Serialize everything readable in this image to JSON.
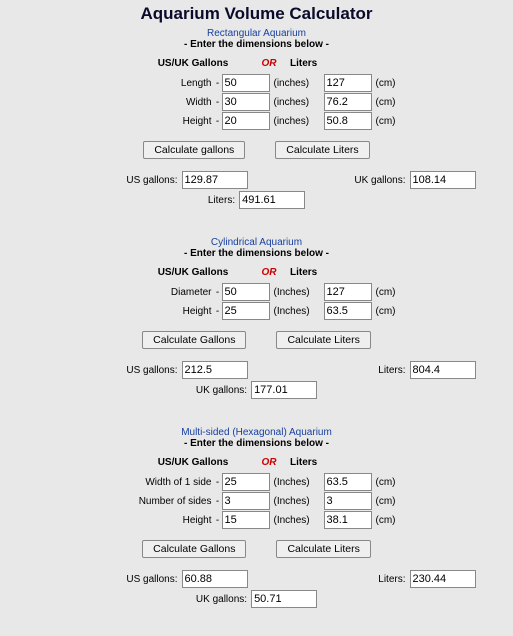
{
  "title": "Aquarium Volume Calculator",
  "headers": {
    "usuk": "US/UK Gallons",
    "or": "OR",
    "liters": "Liters"
  },
  "instruction": "- Enter the dimensions below -",
  "rect": {
    "title": "Rectangular Aquarium",
    "rows": {
      "length": {
        "label": "Length",
        "in": "50",
        "cm": "127"
      },
      "width": {
        "label": "Width",
        "in": "30",
        "cm": "76.2"
      },
      "height": {
        "label": "Height",
        "in": "20",
        "cm": "50.8"
      }
    },
    "unit_in": "(inches)",
    "unit_cm": "(cm)",
    "btn_gal": "Calculate gallons",
    "btn_lit": "Calculate Liters",
    "res": {
      "us_label": "US gallons:",
      "us": "129.87",
      "uk_label": "UK gallons:",
      "uk": "108.14",
      "l_label": "Liters:",
      "l": "491.61"
    }
  },
  "cyl": {
    "title": "Cylindrical  Aquarium",
    "rows": {
      "diameter": {
        "label": "Diameter",
        "in": "50",
        "cm": "127"
      },
      "height": {
        "label": "Height",
        "in": "25",
        "cm": "63.5"
      }
    },
    "unit_in": "(Inches)",
    "unit_cm": "(cm)",
    "btn_gal": "Calculate Gallons",
    "btn_lit": "Calculate Liters",
    "res": {
      "us_label": "US gallons:",
      "us": "212.5",
      "l_label": "Liters:",
      "l": "804.4",
      "uk_label": "UK gallons:",
      "uk": "177.01"
    }
  },
  "hex": {
    "title": "Multi-sided (Hexagonal)  Aquarium",
    "rows": {
      "side": {
        "label": "Width of 1 side",
        "in": "25",
        "cm": "63.5"
      },
      "sides": {
        "label": "Number of sides",
        "in": "3",
        "cm": "3"
      },
      "height": {
        "label": "Height",
        "in": "15",
        "cm": "38.1"
      }
    },
    "unit_in": "(Inches)",
    "unit_cm": "(cm)",
    "btn_gal": "Calculate Gallons",
    "btn_lit": "Calculate Liters",
    "res": {
      "us_label": "US gallons:",
      "us": "60.88",
      "l_label": "Liters:",
      "l": "230.44",
      "uk_label": "UK gallons:",
      "uk": "50.71"
    }
  }
}
